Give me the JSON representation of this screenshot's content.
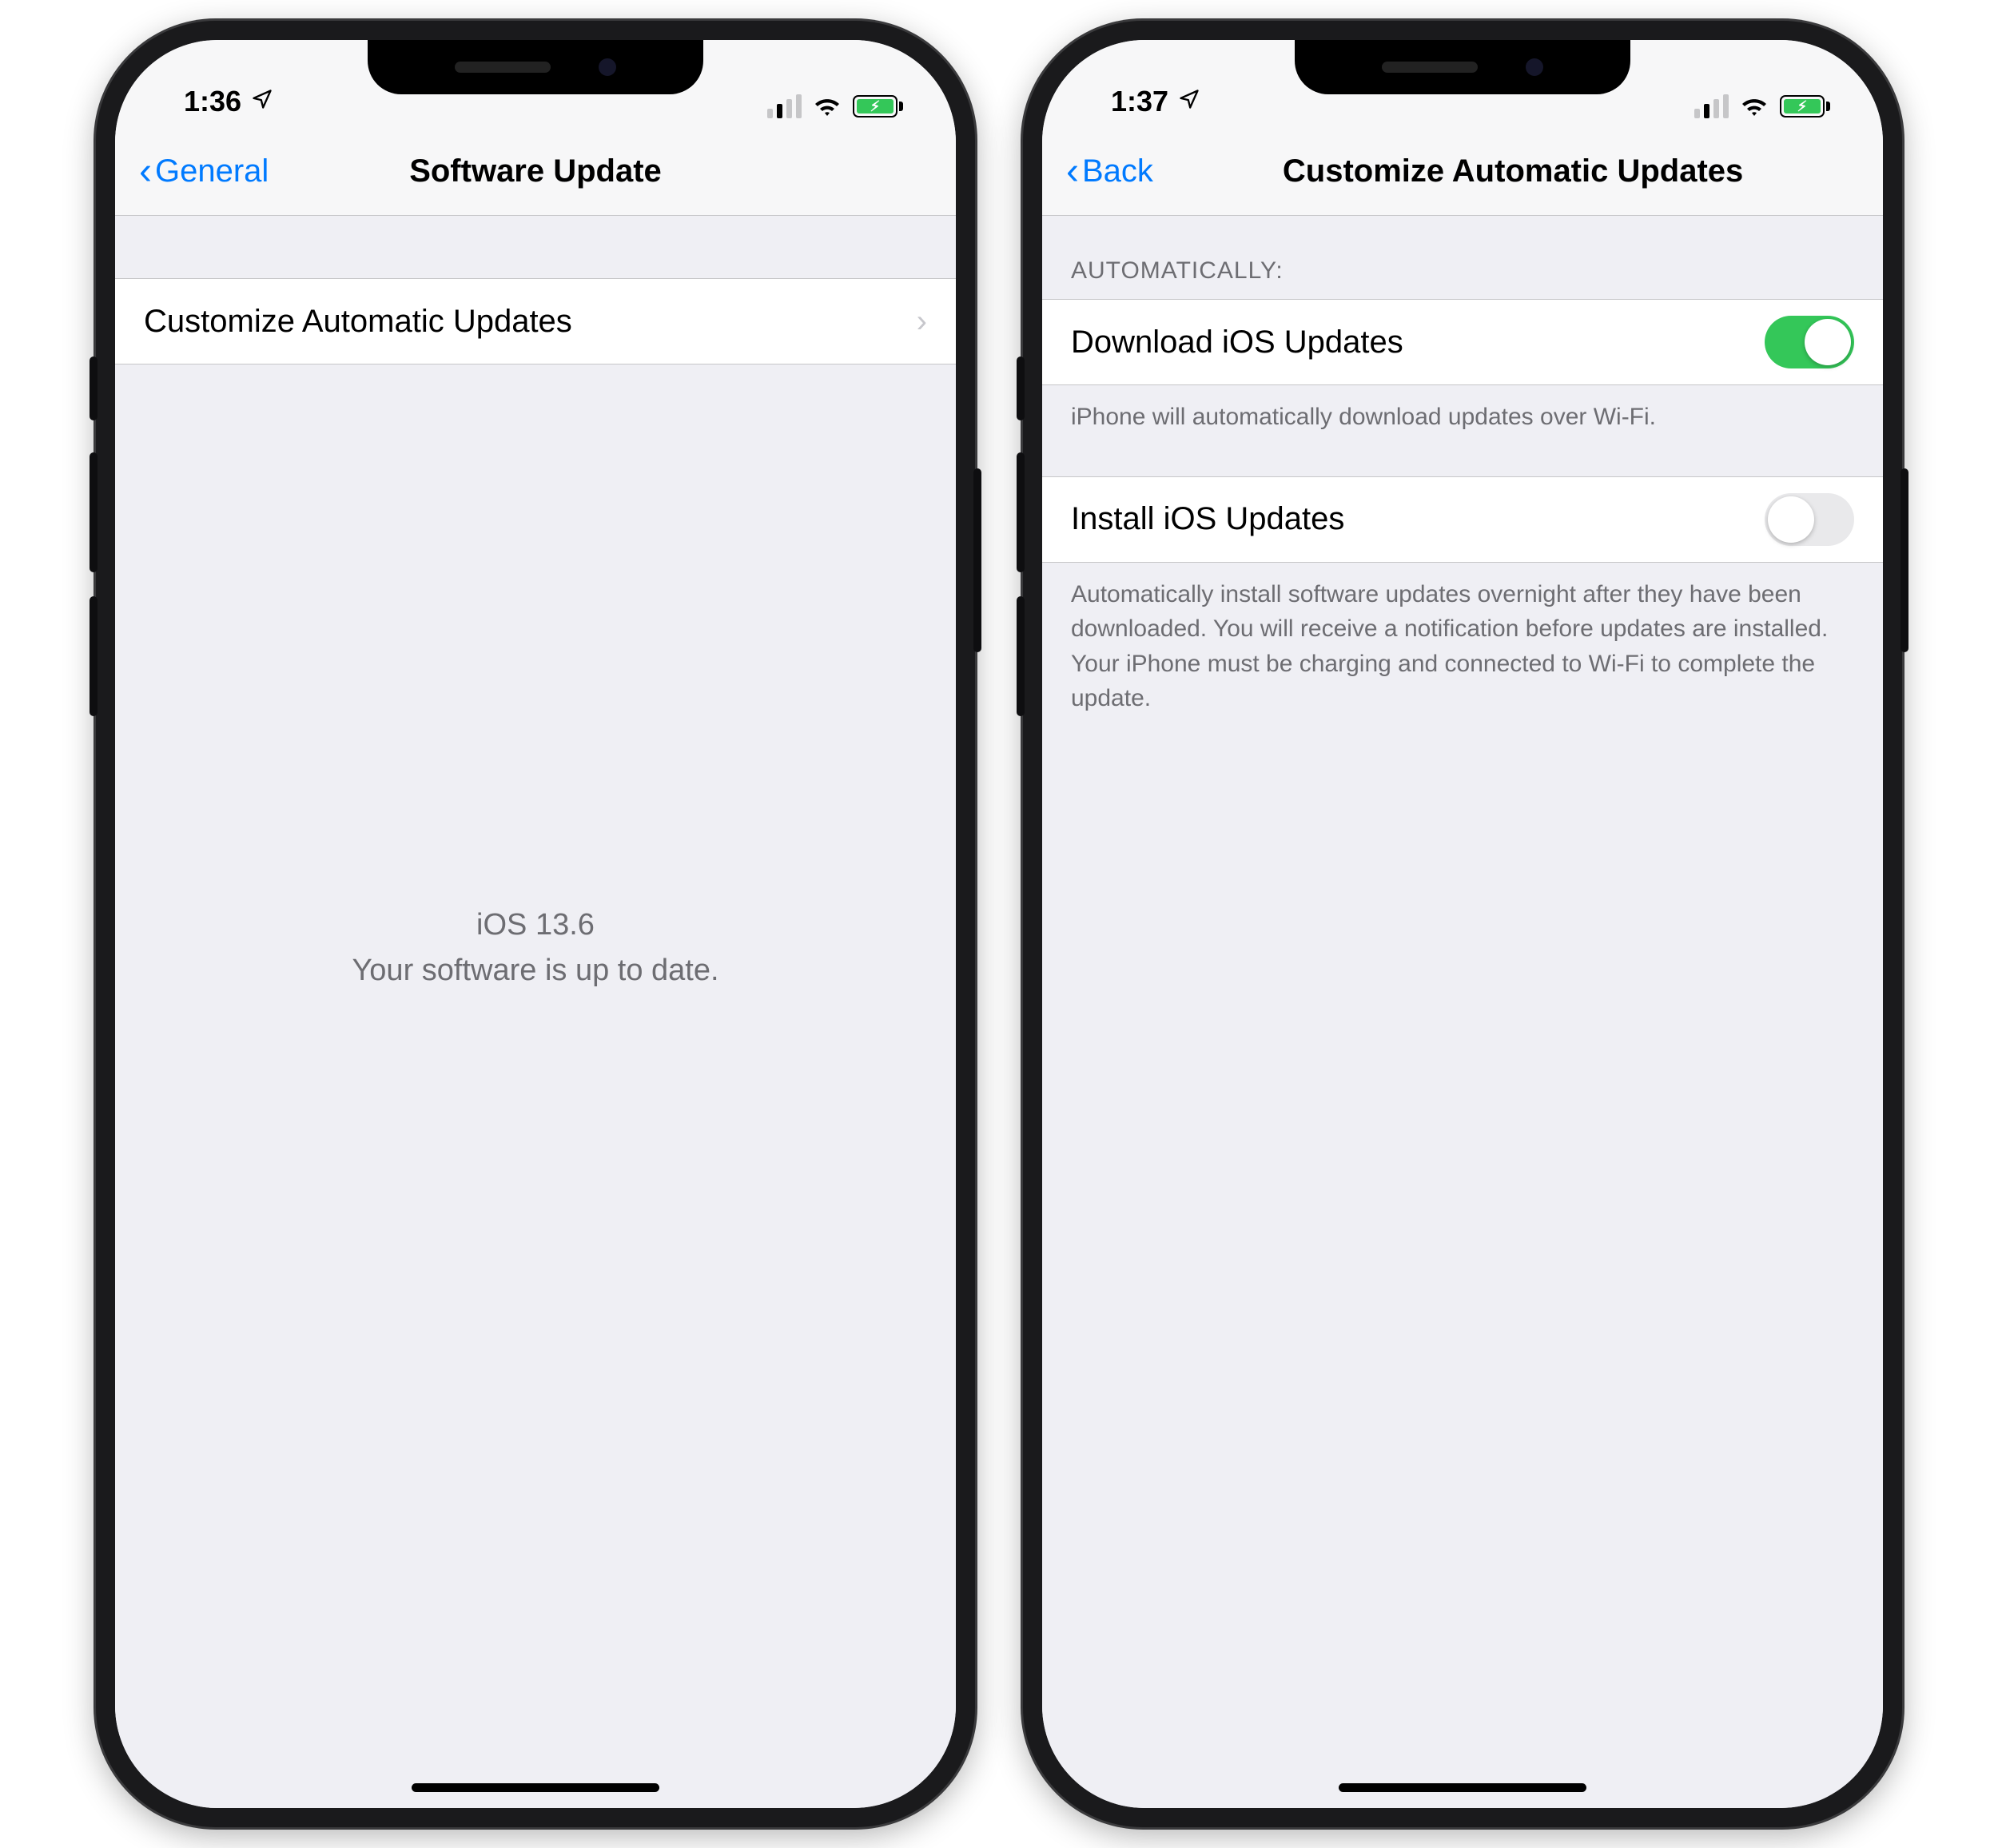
{
  "phone1": {
    "status": {
      "time": "1:36"
    },
    "nav": {
      "back": "General",
      "title": "Software Update"
    },
    "row1": "Customize Automatic Updates",
    "message_line1": "iOS 13.6",
    "message_line2": "Your software is up to date."
  },
  "phone2": {
    "status": {
      "time": "1:37"
    },
    "nav": {
      "back": "Back",
      "title": "Customize Automatic Updates"
    },
    "section_header": "AUTOMATICALLY:",
    "row_download": "Download iOS Updates",
    "download_on": true,
    "download_footer": "iPhone will automatically download updates over Wi-Fi.",
    "row_install": "Install iOS Updates",
    "install_on": false,
    "install_footer": "Automatically install software updates overnight after they have been downloaded. You will receive a notification before updates are installed. Your iPhone must be charging and connected to Wi-Fi to complete the update."
  }
}
